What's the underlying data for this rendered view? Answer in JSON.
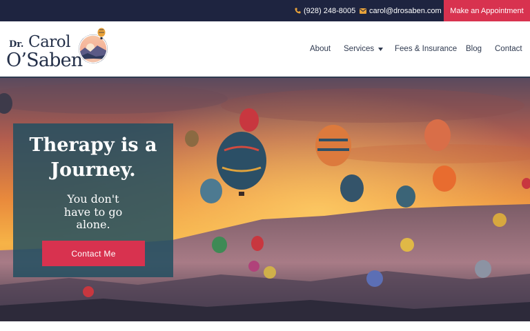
{
  "topbar": {
    "phone": "(928) 248-8005",
    "email": "carol@drosaben.com",
    "appointment_label": "Make an Appointment"
  },
  "logo": {
    "prefix": "Dr.",
    "first_name": "Carol",
    "last_name": "O’Saben"
  },
  "nav": {
    "about": "About",
    "services": "Services",
    "fees": "Fees & Insurance",
    "blog": "Blog",
    "contact": "Contact"
  },
  "hero": {
    "title_line1": "Therapy is a",
    "title_line2": "Journey.",
    "subtitle_line1": "You don't",
    "subtitle_line2": "have to go",
    "subtitle_line3": "alone.",
    "button_label": "Contact Me"
  },
  "colors": {
    "topbar_bg": "#1e2440",
    "accent": "#d8324f",
    "card_bg": "#234f61",
    "text_dark": "#2f3a50",
    "icon_gold": "#e8a23a"
  },
  "icons": {
    "phone": "phone-icon",
    "email": "envelope-icon",
    "services_caret": "chevron-down-icon"
  }
}
